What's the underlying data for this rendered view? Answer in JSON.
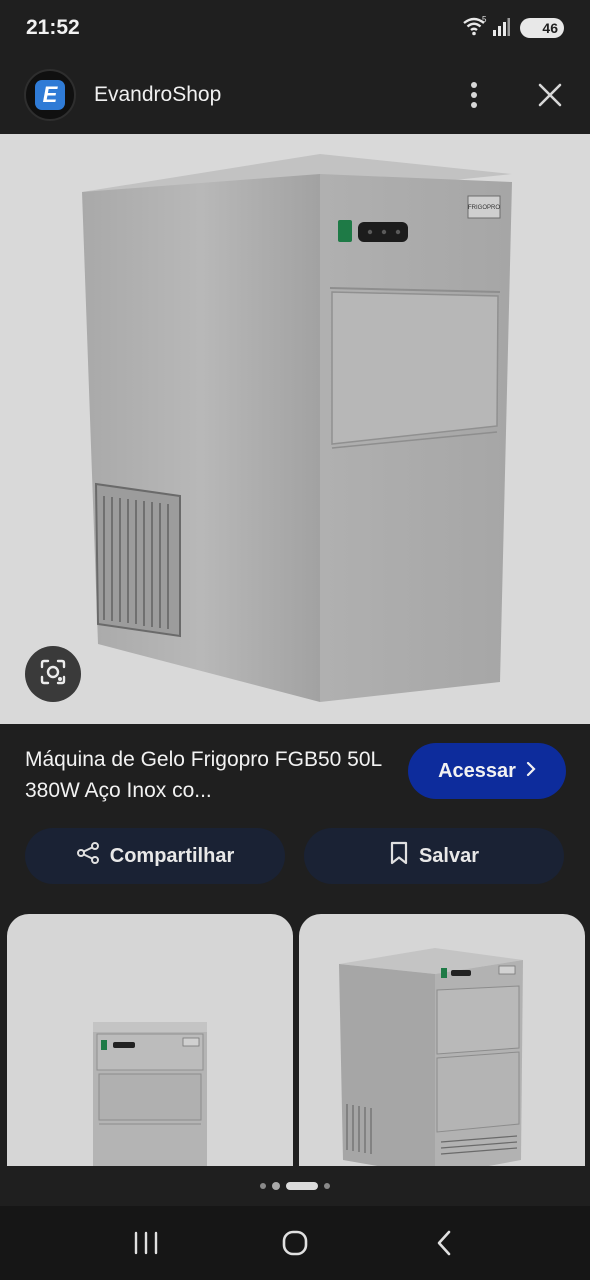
{
  "status_bar": {
    "time": "21:52",
    "wifi_label": "5",
    "battery": "46"
  },
  "header": {
    "logo_letter": "E",
    "site_name": "EvandroShop"
  },
  "product": {
    "title": "Máquina de Gelo Frigopro FGB50 50L 380W Aço Inox co...",
    "brand_plate": "FRIGOPRO"
  },
  "actions": {
    "visit_label": "Acessar",
    "share_label": "Compartilhar",
    "save_label": "Salvar"
  },
  "carousel": {
    "dot_count": 4,
    "active_index": 2
  },
  "colors": {
    "page_bg": "#1f1f1f",
    "visit_button_bg": "#0d2c9c",
    "pill_bg": "#1a2234",
    "image_bg": "#d9d9d9"
  },
  "icons": [
    "wifi-icon",
    "signal-icon",
    "battery-icon",
    "more-vert-icon",
    "close-icon",
    "lens-icon",
    "chevron-right-icon",
    "share-icon",
    "bookmark-icon",
    "recents-icon",
    "home-icon",
    "back-icon"
  ]
}
